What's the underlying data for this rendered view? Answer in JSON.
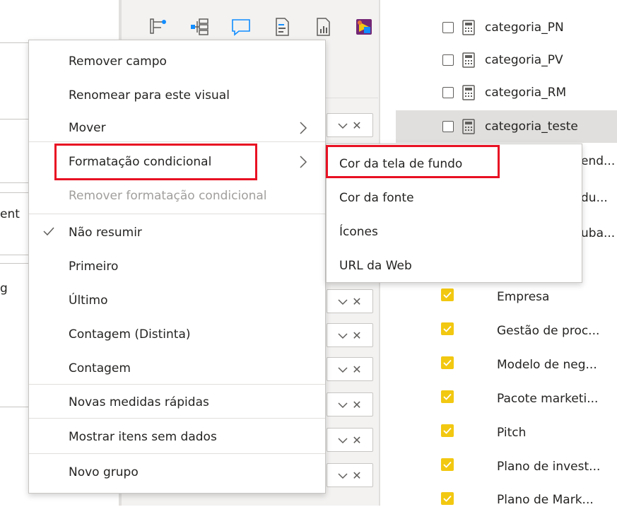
{
  "left_pane": {
    "fragment_1": "ent",
    "fragment_2": "g"
  },
  "viz_pane": {
    "icons": [
      "hierarchy-slicer-icon",
      "decomposition-tree-icon",
      "qa-bubble-icon",
      "paginated-report-icon",
      "report-icon",
      "power-apps-icon"
    ],
    "pill_remove_symbol": "✕"
  },
  "fields_pane": {
    "calculated_fields": [
      {
        "label": "categoria_PN",
        "checked": false
      },
      {
        "label": "categoria_PV",
        "checked": false
      },
      {
        "label": "categoria_RM",
        "checked": false
      },
      {
        "label": "categoria_teste",
        "checked": false,
        "highlighted": true
      }
    ],
    "partial_rows": [
      "end...",
      "du...",
      "uba..."
    ],
    "checked_items": [
      "Empresa",
      "Gestão de proc...",
      "Modelo de neg...",
      "Pacote marketi...",
      "Pitch",
      "Plano de invest...",
      "Plano de Mark..."
    ],
    "check_color": "#f2c811"
  },
  "context_menu": {
    "items": [
      {
        "label": "Remover campo"
      },
      {
        "label": "Renomear para este visual"
      },
      {
        "label": "Mover",
        "has_submenu": true
      },
      {
        "label": "Formatação condicional",
        "has_submenu": true,
        "highlighted": true
      },
      {
        "label": "Remover formatação condicional",
        "disabled": true
      },
      {
        "label": "Não resumir",
        "checked": true
      },
      {
        "label": "Primeiro"
      },
      {
        "label": "Último"
      },
      {
        "label": "Contagem (Distinta)"
      },
      {
        "label": "Contagem"
      },
      {
        "label": "Novas medidas rápidas"
      },
      {
        "label": "Mostrar itens sem dados"
      },
      {
        "label": "Novo grupo"
      }
    ]
  },
  "submenu": {
    "items": [
      {
        "label": "Cor da tela de fundo",
        "highlighted": true
      },
      {
        "label": "Cor da fonte"
      },
      {
        "label": "Ícones"
      },
      {
        "label": "URL da Web"
      }
    ]
  },
  "colors": {
    "highlight_box": "#e81123",
    "accent_blue": "#118dff",
    "accent_yellow": "#f2c811"
  }
}
